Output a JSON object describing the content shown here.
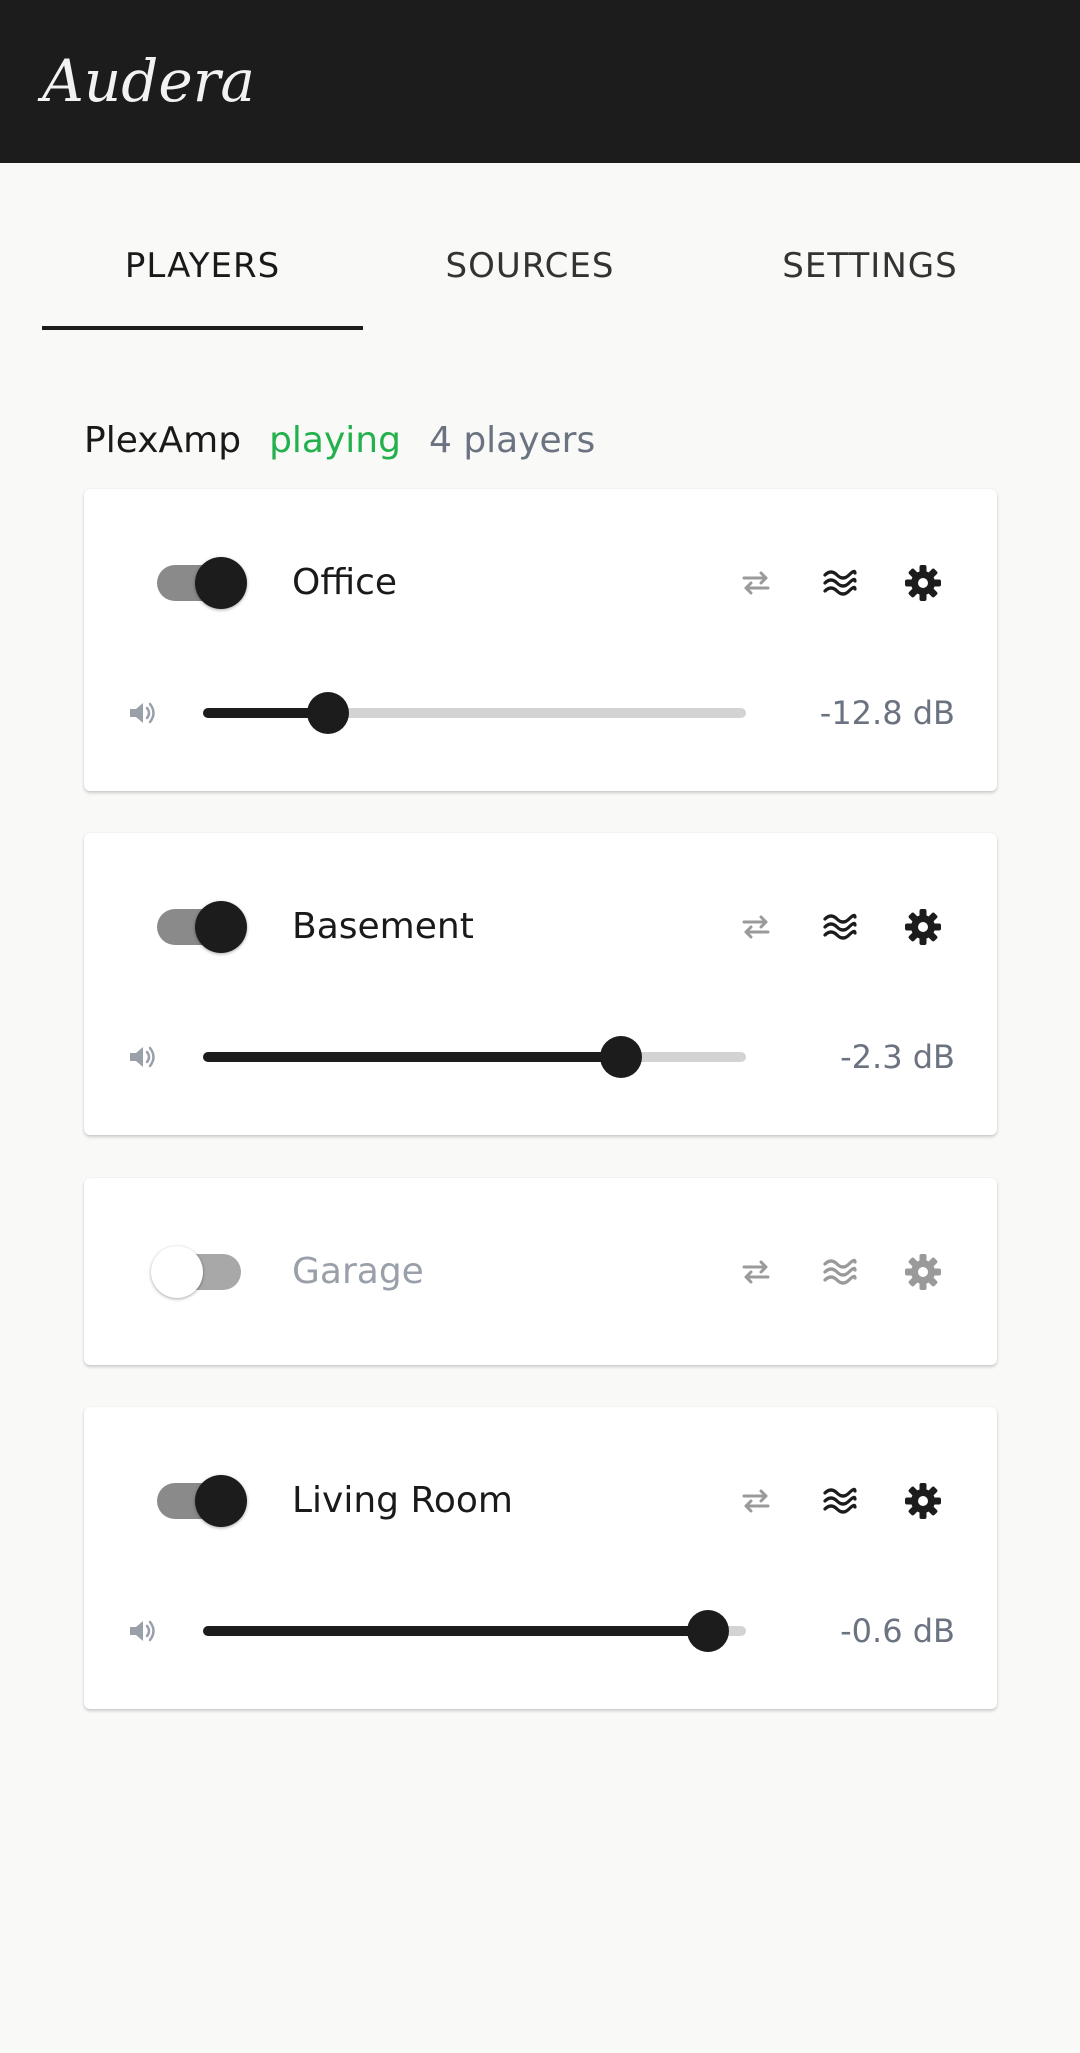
{
  "app": {
    "title": "Audera"
  },
  "tabs": [
    {
      "label": "PLAYERS",
      "active": true
    },
    {
      "label": "SOURCES",
      "active": false
    },
    {
      "label": "SETTINGS",
      "active": false
    }
  ],
  "status": {
    "source": "PlexAmp",
    "state": "playing",
    "count": "4 players",
    "state_color": "#22b14c"
  },
  "players": [
    {
      "name": "Office",
      "enabled": true,
      "volume_label": "-12.8 dB",
      "volume_fraction": 0.23
    },
    {
      "name": "Basement",
      "enabled": true,
      "volume_label": "-2.3 dB",
      "volume_fraction": 0.77
    },
    {
      "name": "Garage",
      "enabled": false
    },
    {
      "name": "Living Room",
      "enabled": true,
      "volume_label": "-0.6 dB",
      "volume_fraction": 0.93
    }
  ],
  "icons": {
    "sync": "sync-arrows-icon",
    "equalizer": "wave-equalizer-icon",
    "settings": "gear-icon",
    "volume": "volume-icon"
  }
}
